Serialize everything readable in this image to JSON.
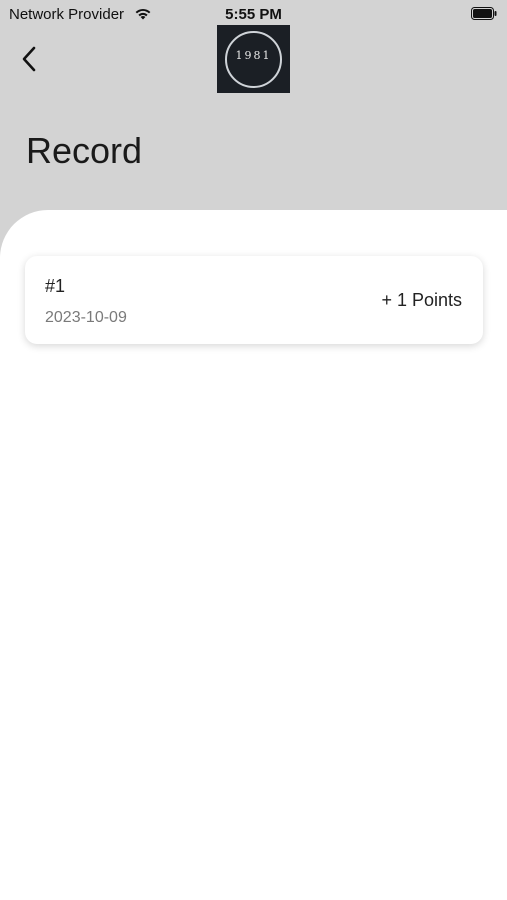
{
  "status_bar": {
    "carrier": "Network Provider",
    "time": "5:55 PM",
    "wifi_icon": "wifi-icon",
    "battery_icon": "battery-icon"
  },
  "header": {
    "back_icon": "chevron-left-icon",
    "logo": {
      "year": "1981",
      "sub": ""
    },
    "title": "Record"
  },
  "records": [
    {
      "number": "#1",
      "date": "2023-10-09",
      "points": "+ 1 Points"
    }
  ],
  "colors": {
    "header_bg": "#d3d3d3",
    "content_bg": "#ffffff",
    "logo_bg": "#1b1f25",
    "text_primary": "#222222",
    "text_secondary": "#7a7a7a"
  }
}
